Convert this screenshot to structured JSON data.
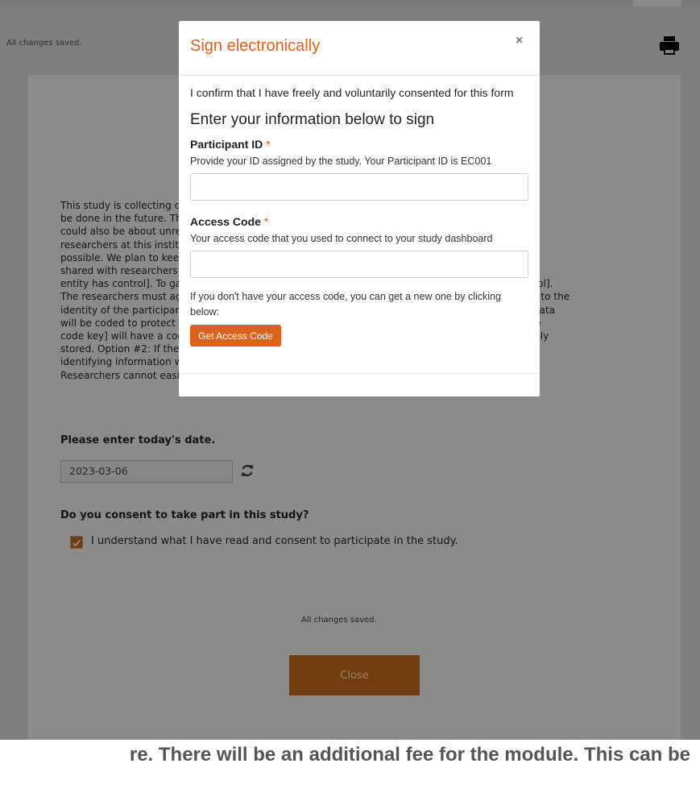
{
  "topbar": {
    "status": "All changes saved."
  },
  "form": {
    "paragraph_lines": [
      "This study is collecting data that may be stored and used for future research studies that may",
      "be done in the future. These studies may be about similar research topics. However, research",
      "could also be about unrelated topics. The future research studies may be done by",
      "researchers at this institution or other institutions. Sharing your data can make more research",
      "possible. We plan to keep your data for an indefinite period of time. Your data may be",
      "shared with researchers at other institutions. Your data will be maintained by [indicate which",
      "entity has control]. To gain access to your data, researchers must [indicate which entity has control].",
      "The researchers must agree that they will not try to identify you. Your data will not be linked back to the",
      "identity of the participants. We will take reasonable steps to protect it as much as possible. Your data",
      "will be coded to protect your identity. Researchers who use the data [indicate which entity has the",
      "code key] will have a code key, which may allow them to identify you. The code key will be securely",
      "stored. Option #2: If the data is shared or used for future research, then your name and",
      "identifying information will be removed from the data before it is given to other researchers.",
      "Researchers cannot easily link your identifying information to the data."
    ],
    "date_question": "Please enter today's date.",
    "date_value": "2023-03-06",
    "consent_question": "Do you consent to take part in this study?",
    "consent_label": "I understand what I have read and consent to participate in the study.",
    "consent_checked": true,
    "bottom_status": "All changes saved.",
    "close_label": "Close"
  },
  "modal": {
    "title": "Sign electronically",
    "close_symbol": "×",
    "confirm_text": "I confirm that I have freely and voluntarily consented for this form",
    "heading": "Enter your information below to sign",
    "participant": {
      "label": "Participant ID",
      "required": "*",
      "help": "Provide your ID assigned by the study. Your Participant ID is EC001",
      "value": ""
    },
    "access_code": {
      "label": "Access Code",
      "required": "*",
      "help": "Your access code that you used to connect to your study dashboard",
      "value": ""
    },
    "note_lines": [
      "If you don't have your access code, you can get a new one by clicking",
      "below:"
    ],
    "get_code_label": "Get Access Code"
  },
  "ticker": {
    "text": "re. There will be an additional fee for the module. This can be"
  },
  "colors": {
    "accent": "#d9621f",
    "overlay": "#7f7f7f",
    "close_button_dimmed": "#6f3d10"
  },
  "icons": {
    "print": "printer-icon",
    "refresh": "refresh-icon",
    "check": "check-icon"
  }
}
